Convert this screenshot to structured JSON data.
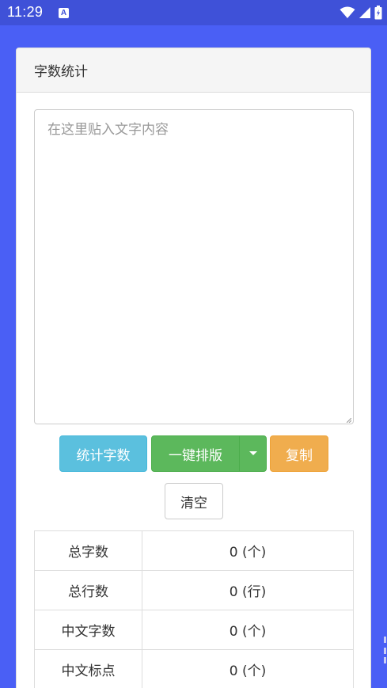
{
  "status_bar": {
    "time": "11:29",
    "notification_icon": "a-notification-icon",
    "icons": [
      "wifi-icon",
      "signal-icon",
      "battery-icon"
    ]
  },
  "panel": {
    "title": "字数统计"
  },
  "editor": {
    "placeholder": "在这里贴入文字内容",
    "value": ""
  },
  "buttons": {
    "count": "统计字数",
    "format": "一键排版",
    "copy": "复制",
    "clear": "清空"
  },
  "stats": [
    {
      "label": "总字数",
      "value": "0 (个)"
    },
    {
      "label": "总行数",
      "value": "0 (行)"
    },
    {
      "label": "中文字数",
      "value": "0 (个)"
    },
    {
      "label": "中文标点",
      "value": "0 (个)"
    }
  ],
  "colors": {
    "background": "#4a5ff5",
    "status_bar": "#3f51d8",
    "info": "#5bc0de",
    "success": "#5cb85c",
    "warning": "#f0ad4e"
  }
}
